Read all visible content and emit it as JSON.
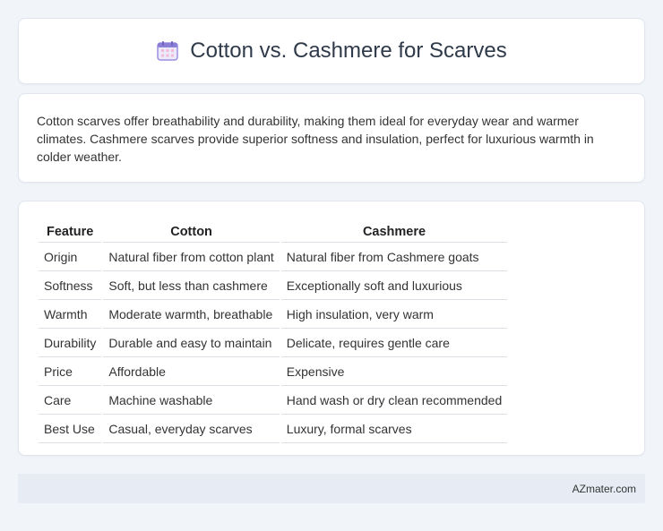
{
  "header": {
    "title": "Cotton vs. Cashmere for Scarves",
    "icon": "calendar-icon"
  },
  "intro": {
    "text": "Cotton scarves offer breathability and durability, making them ideal for everyday wear and warmer climates. Cashmere scarves provide superior softness and insulation, perfect for luxurious warmth in colder weather."
  },
  "table": {
    "headers": [
      "Feature",
      "Cotton",
      "Cashmere"
    ],
    "rows": [
      [
        "Origin",
        "Natural fiber from cotton plant",
        "Natural fiber from Cashmere goats"
      ],
      [
        "Softness",
        "Soft, but less than cashmere",
        "Exceptionally soft and luxurious"
      ],
      [
        "Warmth",
        "Moderate warmth, breathable",
        "High insulation, very warm"
      ],
      [
        "Durability",
        "Durable and easy to maintain",
        "Delicate, requires gentle care"
      ],
      [
        "Price",
        "Affordable",
        "Expensive"
      ],
      [
        "Care",
        "Machine washable",
        "Hand wash or dry clean recommended"
      ],
      [
        "Best Use",
        "Casual, everyday scarves",
        "Luxury, formal scarves"
      ]
    ]
  },
  "footer": {
    "brand": "AZmater.com"
  },
  "colors": {
    "icon_accent": "#8b7fd6",
    "icon_grid": "#f2b9d6",
    "footer_bg": "#e6ebf4"
  }
}
